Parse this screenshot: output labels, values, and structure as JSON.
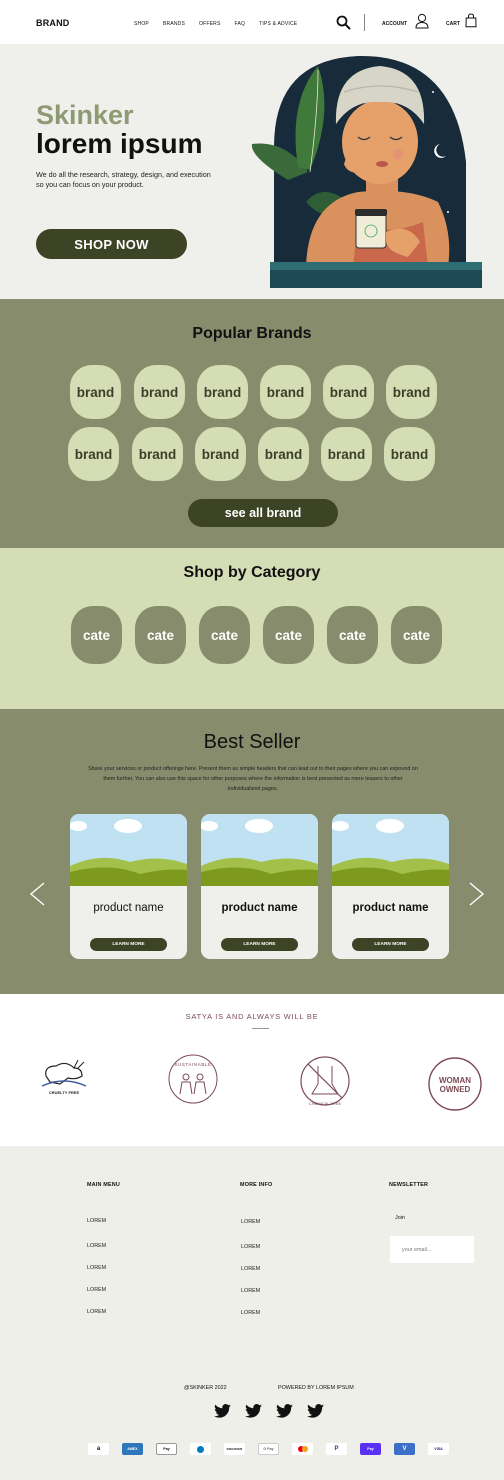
{
  "nav": {
    "brand": "BRAND",
    "links": [
      "SHOP",
      "BRANDS",
      "OFFERS",
      "FAQ",
      "TIPS & ADVICE"
    ],
    "account": "ACCOUNT",
    "cart": "CART"
  },
  "hero": {
    "kicker": "Skinker",
    "title": "lorem ipsum",
    "description": "We do all the research, strategy, design, and execution so you can focus on your product.",
    "button": "SHOP NOW"
  },
  "brands": {
    "title": "Popular Brands",
    "row1": [
      "brand",
      "brand",
      "brand",
      "brand",
      "brand",
      "brand"
    ],
    "row2": [
      "brand",
      "brand",
      "brand",
      "brand",
      "brand",
      "brand"
    ],
    "see_all": "see all brand"
  },
  "categories": {
    "title": "Shop by Category",
    "items": [
      "cate",
      "cate",
      "cate",
      "cate",
      "cate",
      "cate"
    ]
  },
  "best_seller": {
    "title": "Best Seller",
    "description": "Share your services or product offerings here. Present them as simple headers that can lead out to their pages where you can expound on them further. You can also use this space for other purposes where the information is best presented as mere teasers to other individualized pages.",
    "products": [
      {
        "name": "product name",
        "button": "LEARN MORE"
      },
      {
        "name": "product name",
        "button": "LEARN MORE"
      },
      {
        "name": "product name",
        "button": "LEARN MORE"
      }
    ]
  },
  "values": {
    "title": "SATYA IS AND ALWAYS WILL BE",
    "cruelty_free": "CRUELTY FREE",
    "sustainable": "SUSTAINABLE",
    "chemical_free": "CHEMICAL FREE",
    "woman": "WOMAN",
    "owned": "OWNED"
  },
  "footer": {
    "main_menu": {
      "heading": "MAIN MENU",
      "items": [
        "LOREM",
        "LOREM",
        "LOREM",
        "LOREM",
        "LOREM"
      ]
    },
    "more_info": {
      "heading": "MORE INFO",
      "items": [
        "LOREM",
        "LOREM",
        "LOREM",
        "LOREM",
        "LOREM"
      ]
    },
    "newsletter": {
      "heading": "NEWSLETTER",
      "join": "Join",
      "placeholder": "your email..."
    },
    "copyright": "@SKINKER 2022",
    "powered": "POWERED BY LOREM IPSUM",
    "payments": [
      "a",
      "AMEX",
      "Pay",
      "",
      "DISCOVER",
      "G Pay",
      "",
      "P",
      "Pay",
      "V",
      "VISA"
    ]
  },
  "colors": {
    "olive_dark": "#3d4426",
    "sage": "#878c6c",
    "light_sage": "#d5ddb5",
    "hero_bg": "#efefeb",
    "accent_text": "#8f9a74"
  }
}
